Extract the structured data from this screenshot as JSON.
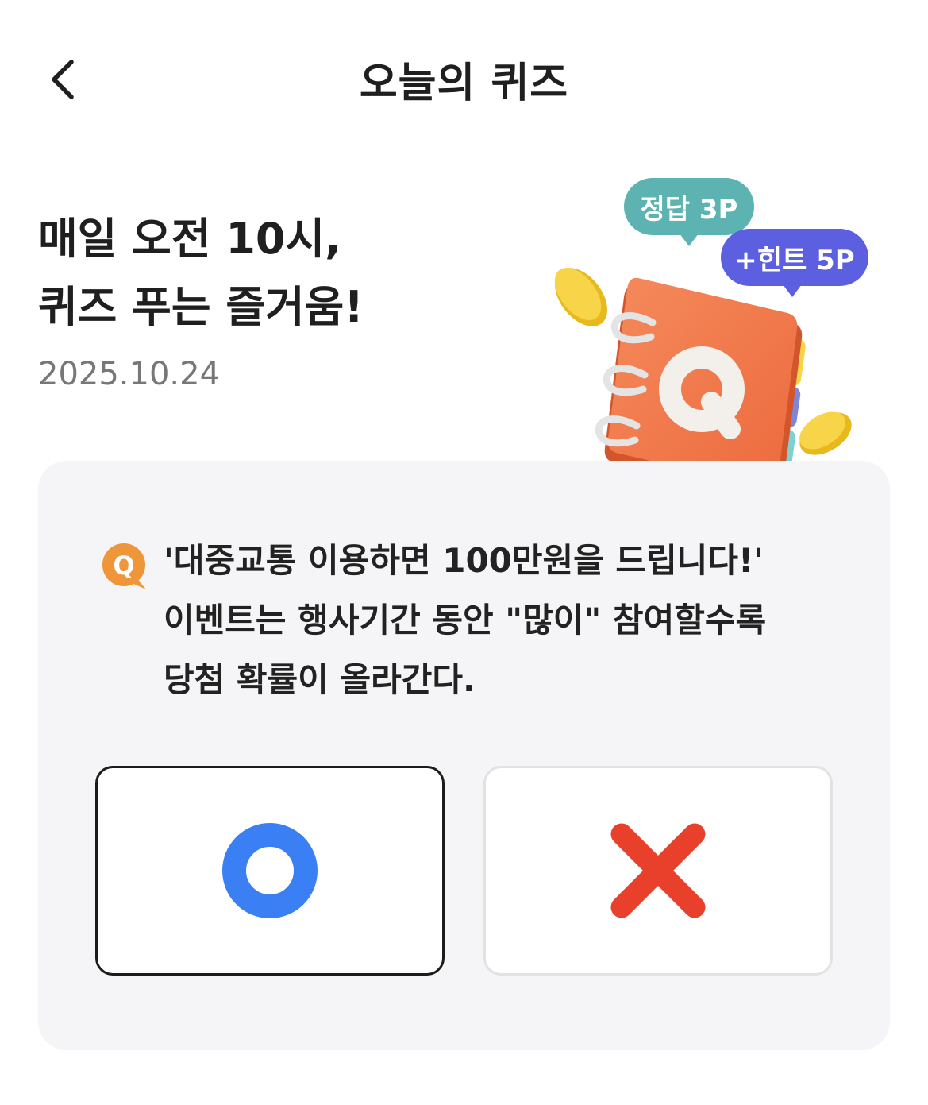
{
  "header": {
    "title": "오늘의 퀴즈",
    "back_icon": "chevron-left-icon"
  },
  "hero": {
    "heading_line1": "매일 오전 10시,",
    "heading_line2": "퀴즈 푸는 즐거움!",
    "date": "2025.10.24"
  },
  "illustration": {
    "answer_reward": "정답 3P",
    "hint_reward": "+힌트 5P",
    "answer_bubble_color": "#5db3b1",
    "hint_bubble_color": "#5b5fe0",
    "book_icon": "quiz-book-icon",
    "book_letter": "Q"
  },
  "quiz": {
    "badge_letter": "Q",
    "badge_color": "#f0963a",
    "question_lines": [
      "'대중교통 이용하면 100만원을 드립니다!'",
      "이벤트는 행사기간 동안 \"많이\" 참여할수록",
      "당첨 확률이 올라간다."
    ],
    "options": [
      {
        "id": "o",
        "icon": "circle-o-icon",
        "color": "#3a7ff3",
        "selected": true
      },
      {
        "id": "x",
        "icon": "cross-x-icon",
        "color": "#e8402a",
        "selected": false
      }
    ]
  }
}
